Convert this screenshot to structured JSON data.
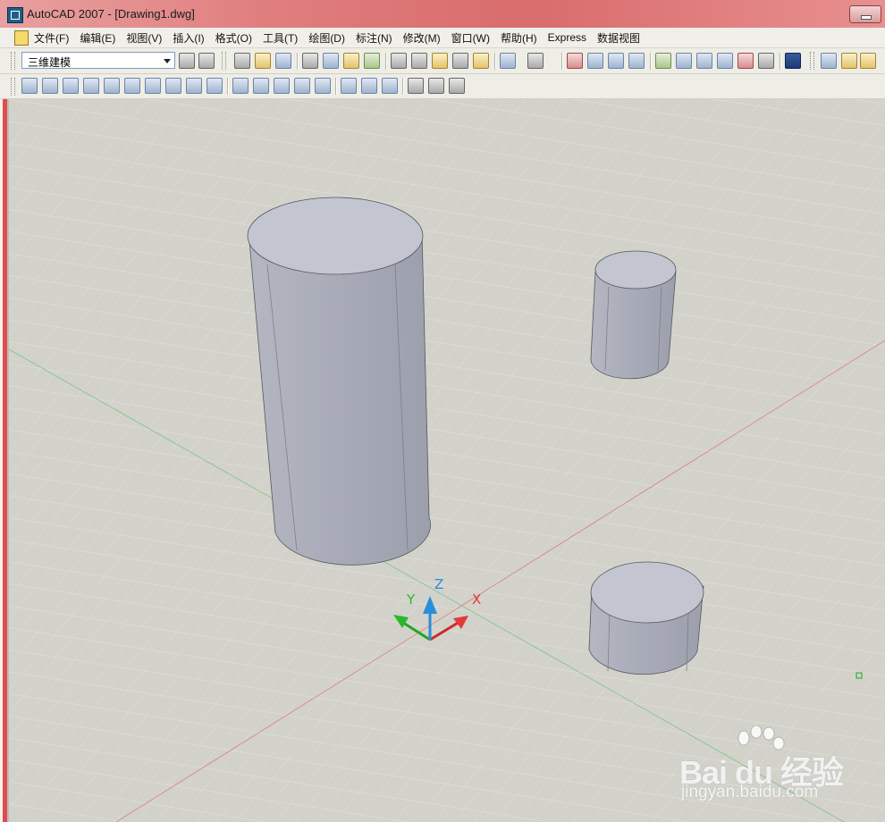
{
  "window": {
    "title": "AutoCAD 2007 - [Drawing1.dwg]"
  },
  "menu": {
    "items": [
      "文件(F)",
      "编辑(E)",
      "视图(V)",
      "插入(I)",
      "格式(O)",
      "工具(T)",
      "绘图(D)",
      "标注(N)",
      "修改(M)",
      "窗口(W)",
      "帮助(H)",
      "Express",
      "数据视图"
    ]
  },
  "toolbar": {
    "workspace_value": "三维建模"
  },
  "ucs": {
    "x_label": "X",
    "y_label": "Y",
    "z_label": "Z"
  },
  "colors": {
    "title_bar": "#e07e7e",
    "viewport_background": "#d2d2cb",
    "grid_line": "#e2e2dd",
    "cylinder_body": "#a7aab6",
    "cylinder_top": "#c2c5cf",
    "x_axis": "#e03a3a",
    "y_axis": "#2ab82a",
    "z_axis": "#2a8fd8"
  },
  "watermark": {
    "brand": "Bai du 经验",
    "url": "jingyan.baidu.com"
  }
}
